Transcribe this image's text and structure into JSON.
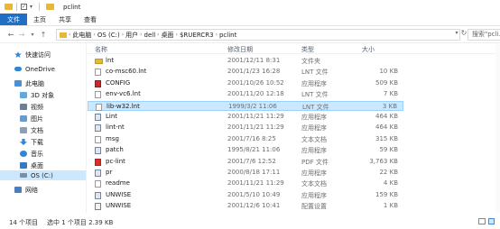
{
  "window": {
    "title": "pclint"
  },
  "ribbon": {
    "tabs": [
      "文件",
      "主页",
      "共享",
      "查看"
    ]
  },
  "address": {
    "crumbs": [
      "此电脑",
      "OS (C:)",
      "用户",
      "dell",
      "桌面",
      "$RUERCR3",
      "pclint"
    ],
    "search_placeholder": "搜索\"pcli..."
  },
  "sidebar": {
    "items": [
      {
        "label": "快速访问",
        "icon": "star-icon",
        "color": "#2f86d6"
      },
      {
        "label": "OneDrive",
        "icon": "cloud-icon",
        "color": "#2f86d6"
      },
      {
        "label": "此电脑",
        "icon": "computer-icon",
        "color": "#4a90d9"
      },
      {
        "label": "3D 对象",
        "icon": "cube-icon",
        "color": "#62a8e0"
      },
      {
        "label": "视频",
        "icon": "video-icon",
        "color": "#6a7f99"
      },
      {
        "label": "图片",
        "icon": "picture-icon",
        "color": "#6a9bd0"
      },
      {
        "label": "文档",
        "icon": "document-icon",
        "color": "#8aa0b8"
      },
      {
        "label": "下载",
        "icon": "download-icon",
        "color": "#2f86d6"
      },
      {
        "label": "音乐",
        "icon": "music-icon",
        "color": "#2f86d6"
      },
      {
        "label": "桌面",
        "icon": "desktop-icon",
        "color": "#3a78c0"
      },
      {
        "label": "OS (C:)",
        "icon": "drive-icon",
        "color": "#7a8ea6"
      },
      {
        "label": "网络",
        "icon": "network-icon",
        "color": "#4a7fbf"
      }
    ]
  },
  "list": {
    "columns": [
      "名称",
      "修改日期",
      "类型",
      "大小"
    ],
    "rows": [
      {
        "name": "lnt",
        "date": "2001/12/11 8:31",
        "type": "文件夹",
        "size": "",
        "icon": "folder"
      },
      {
        "name": "co-msc60.lnt",
        "date": "2001/1/23 16:28",
        "type": "LNT 文件",
        "size": "10 KB",
        "icon": "txt"
      },
      {
        "name": "CONFIG",
        "date": "2001/10/26 10:52",
        "type": "应用程序",
        "size": "509 KB",
        "icon": "red"
      },
      {
        "name": "env-vc6.lnt",
        "date": "2001/11/20 12:18",
        "type": "LNT 文件",
        "size": "7 KB",
        "icon": "txt"
      },
      {
        "name": "lib-w32.lnt",
        "date": "1999/3/2 11:06",
        "type": "LNT 文件",
        "size": "3 KB",
        "icon": "txt"
      },
      {
        "name": "Lint",
        "date": "2001/11/21 11:29",
        "type": "应用程序",
        "size": "464 KB",
        "icon": "exe"
      },
      {
        "name": "lint-nt",
        "date": "2001/11/21 11:29",
        "type": "应用程序",
        "size": "464 KB",
        "icon": "exe"
      },
      {
        "name": "msg",
        "date": "2001/7/16 8:25",
        "type": "文本文档",
        "size": "315 KB",
        "icon": "txt"
      },
      {
        "name": "patch",
        "date": "1995/8/21 11:06",
        "type": "应用程序",
        "size": "59 KB",
        "icon": "exe"
      },
      {
        "name": "pc-lint",
        "date": "2001/7/6 12:52",
        "type": "PDF 文件",
        "size": "3,763 KB",
        "icon": "pdf"
      },
      {
        "name": "pr",
        "date": "2000/8/18 17:11",
        "type": "应用程序",
        "size": "22 KB",
        "icon": "exe"
      },
      {
        "name": "readme",
        "date": "2001/11/21 11:29",
        "type": "文本文档",
        "size": "4 KB",
        "icon": "txt"
      },
      {
        "name": "UNWISE",
        "date": "2001/5/10 10:49",
        "type": "应用程序",
        "size": "159 KB",
        "icon": "exe"
      },
      {
        "name": "UNWISE",
        "date": "2001/12/6 10:41",
        "type": "配置设置",
        "size": "1 KB",
        "icon": "cfg"
      }
    ],
    "selected_index": 4
  },
  "status": {
    "count": "14 个项目",
    "selection": "选中 1 个项目 2.39 KB"
  },
  "colors": {
    "accent": "#1f6fc5",
    "selection": "#cce8ff",
    "folder": "#e8b739"
  }
}
